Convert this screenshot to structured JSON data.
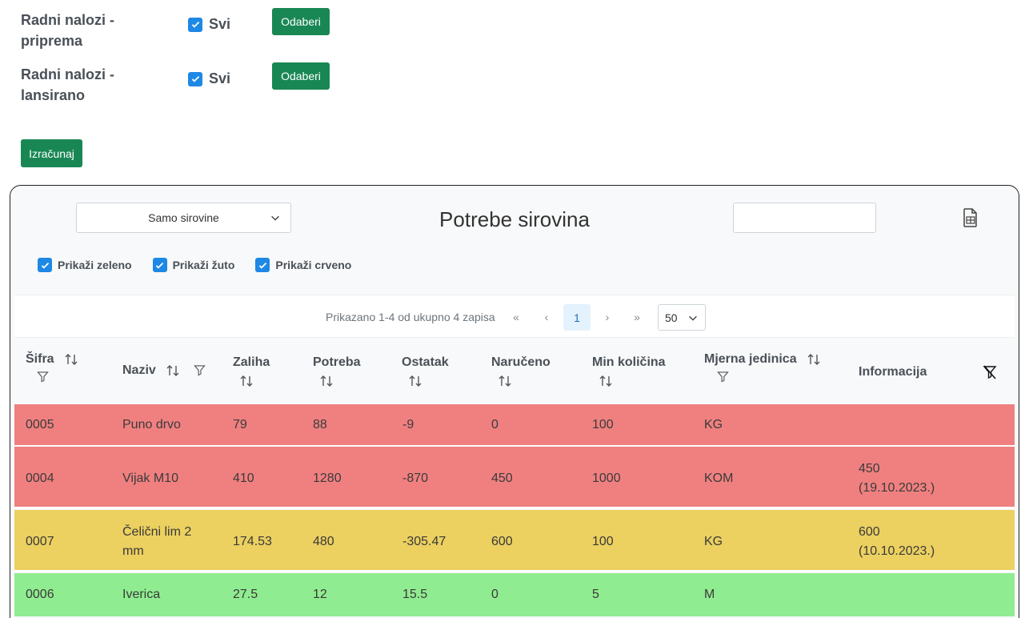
{
  "orders": [
    {
      "label": "Radni nalozi - priprema",
      "check_label": "Svi",
      "checked": true,
      "button": "Odaberi"
    },
    {
      "label": "Radni nalozi - lansirano",
      "check_label": "Svi",
      "checked": true,
      "button": "Odaberi"
    }
  ],
  "calc_button": "Izračunaj",
  "panel": {
    "select_value": "Samo sirovine",
    "title": "Potrebe sirovina",
    "search_value": "",
    "filters": [
      {
        "label": "Prikaži zeleno",
        "checked": true
      },
      {
        "label": "Prikaži žuto",
        "checked": true
      },
      {
        "label": "Prikaži crveno",
        "checked": true
      }
    ]
  },
  "pager": {
    "summary": "Prikazano 1-4 od ukupno 4 zapisa",
    "first": "«",
    "prev": "‹",
    "current_page": "1",
    "next": "›",
    "last": "»",
    "page_size": "50"
  },
  "table": {
    "columns": [
      "Šifra",
      "Naziv",
      "Zaliha",
      "Potreba",
      "Ostatak",
      "Naručeno",
      "Min količina",
      "Mjerna jedinica",
      "Informacija"
    ],
    "rows": [
      {
        "status": "red",
        "sifra": "0005",
        "naziv": "Puno drvo",
        "zaliha": "79",
        "potreba": "88",
        "ostatak": "-9",
        "naruceno": "0",
        "min": "100",
        "jedinica": "KG",
        "info": ""
      },
      {
        "status": "red",
        "sifra": "0004",
        "naziv": "Vijak M10",
        "zaliha": "410",
        "potreba": "1280",
        "ostatak": "-870",
        "naruceno": "450",
        "min": "1000",
        "jedinica": "KOM",
        "info": "450 (19.10.2023.)"
      },
      {
        "status": "yellow",
        "sifra": "0007",
        "naziv": "Čelični lim 2 mm",
        "zaliha": "174.53",
        "potreba": "480",
        "ostatak": "-305.47",
        "naruceno": "600",
        "min": "100",
        "jedinica": "KG",
        "info": "600 (10.10.2023.)"
      },
      {
        "status": "green",
        "sifra": "0006",
        "naziv": "Iverica",
        "zaliha": "27.5",
        "potreba": "12",
        "ostatak": "15.5",
        "naruceno": "0",
        "min": "5",
        "jedinica": "M",
        "info": ""
      }
    ]
  },
  "colors": {
    "red": "#f08080",
    "yellow": "#ecd060",
    "green": "#90ec90",
    "accent": "#198754",
    "checkbox": "#1e88e5"
  }
}
